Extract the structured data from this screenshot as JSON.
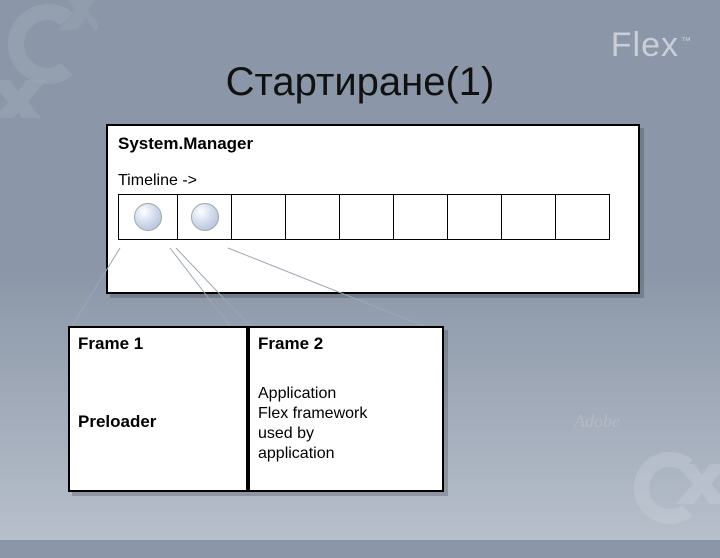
{
  "title": "Стартиране(1)",
  "brand": {
    "flex": "Flex",
    "tm": "™",
    "adobe": "Adobe"
  },
  "sysmgr": {
    "label": "System.Manager",
    "timeline_label": "Timeline ->",
    "timeline": {
      "n_cells": 9,
      "dots_in_cells": [
        0,
        1
      ]
    }
  },
  "frame1": {
    "label": "Frame 1",
    "body": "Preloader"
  },
  "frame2": {
    "label": "Frame 2",
    "body": "Application\nFlex framework\nused by\napplication"
  },
  "colors": {
    "panel": "#ffffff",
    "border": "#000000",
    "bg_from": "#8b97a8",
    "bg_to": "#b7bfcb"
  }
}
